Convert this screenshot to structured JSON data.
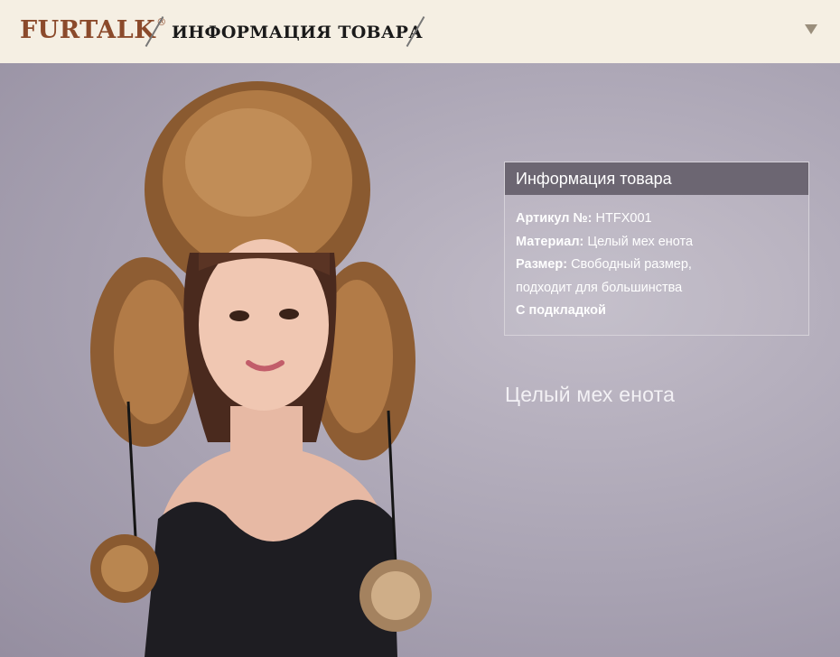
{
  "header": {
    "brand": "FURTALK",
    "registered_mark": "®",
    "section_title": "ИНФОРМАЦИЯ ТОВАРА",
    "toggle_icon": "chevron-down-icon"
  },
  "info_card": {
    "title": "Информация товара",
    "article_label": "Артикул №:",
    "article_value": "HTFX001",
    "material_label": "Материал:",
    "material_value": "Целый мех енота",
    "size_label": "Размер:",
    "size_value": "Свободный размер,",
    "size_value_line2": "подходит для большинства",
    "lining": "С подкладкой"
  },
  "caption": "Целый мех енота",
  "colors": {
    "header_bg": "#f5efe3",
    "brand": "#8b4a2b",
    "banner_bg": "#aca6b5",
    "card_head": "#6c6672"
  }
}
